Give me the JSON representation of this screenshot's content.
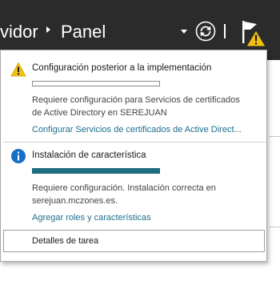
{
  "header": {
    "breadcrumb": [
      "vidor",
      "Panel"
    ]
  },
  "header_icons": {
    "dropdown": "caret-down-icon",
    "refresh": "refresh-icon",
    "notifications": "flag-warning-icon"
  },
  "tasks": [
    {
      "status": "warning",
      "icon": "warning-icon",
      "title": "Configuración posterior a la implementación",
      "progress_percent": 0,
      "description": [
        "Requiere configuración para Servicios de certificados",
        "de Active Directory en SEREJUAN"
      ],
      "link": "Configurar Servicios de certificados de Active Direct..."
    },
    {
      "status": "info",
      "icon": "info-icon",
      "title": "Instalación de característica",
      "progress_percent": 100,
      "description": [
        "Requiere configuración. Instalación correcta en",
        "serejuan.mczones.es."
      ],
      "link": "Agregar roles y características"
    }
  ],
  "footer": {
    "details_label": "Detalles de tarea"
  },
  "colors": {
    "header_bg": "#2b2b2b",
    "warning": "#f2c20f",
    "info": "#1571c7",
    "progress": "#1f6b80",
    "link": "#1e6f8e"
  }
}
